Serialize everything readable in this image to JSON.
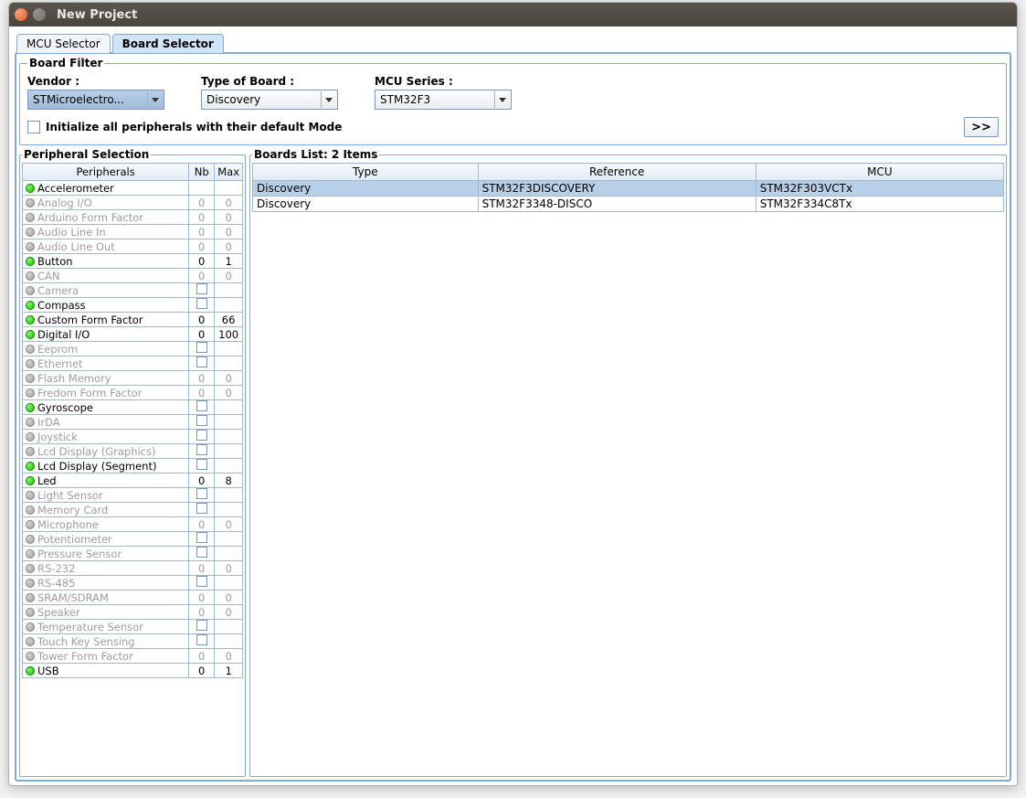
{
  "window": {
    "title": "New Project"
  },
  "tabs": {
    "mcu": "MCU Selector",
    "board": "Board Selector"
  },
  "filter": {
    "legend": "Board Filter",
    "vendor_label": "Vendor :",
    "vendor_value": "STMicroelectro...",
    "type_label": "Type of Board :",
    "type_value": "Discovery",
    "series_label": "MCU Series :",
    "series_value": "STM32F3",
    "init_label": "Initialize all peripherals with their default Mode",
    "next_label": ">>"
  },
  "peripherals": {
    "legend": "Peripheral Selection",
    "col_name": "Peripherals",
    "col_nb": "Nb",
    "col_max": "Max",
    "rows": [
      {
        "name": "Accelerometer",
        "active": true,
        "nb": "",
        "max": "",
        "chk": false
      },
      {
        "name": "Analog I/O",
        "active": false,
        "nb": "0",
        "max": "0",
        "chk": false
      },
      {
        "name": "Arduino Form Factor",
        "active": false,
        "nb": "0",
        "max": "0",
        "chk": false
      },
      {
        "name": "Audio Line In",
        "active": false,
        "nb": "0",
        "max": "0",
        "chk": false
      },
      {
        "name": "Audio Line Out",
        "active": false,
        "nb": "0",
        "max": "0",
        "chk": false
      },
      {
        "name": "Button",
        "active": true,
        "nb": "0",
        "max": "1",
        "chk": false
      },
      {
        "name": "CAN",
        "active": false,
        "nb": "0",
        "max": "0",
        "chk": false
      },
      {
        "name": "Camera",
        "active": false,
        "nb": "",
        "max": "",
        "chk": true
      },
      {
        "name": "Compass",
        "active": true,
        "nb": "",
        "max": "",
        "chk": true
      },
      {
        "name": "Custom Form Factor",
        "active": true,
        "nb": "0",
        "max": "66",
        "chk": false
      },
      {
        "name": "Digital I/O",
        "active": true,
        "nb": "0",
        "max": "100",
        "chk": false
      },
      {
        "name": "Eeprom",
        "active": false,
        "nb": "",
        "max": "",
        "chk": true
      },
      {
        "name": "Ethernet",
        "active": false,
        "nb": "",
        "max": "",
        "chk": true
      },
      {
        "name": "Flash Memory",
        "active": false,
        "nb": "0",
        "max": "0",
        "chk": false
      },
      {
        "name": "Fredom Form Factor",
        "active": false,
        "nb": "0",
        "max": "0",
        "chk": false
      },
      {
        "name": "Gyroscope",
        "active": true,
        "nb": "",
        "max": "",
        "chk": true
      },
      {
        "name": "IrDA",
        "active": false,
        "nb": "",
        "max": "",
        "chk": true
      },
      {
        "name": "Joystick",
        "active": false,
        "nb": "",
        "max": "",
        "chk": true
      },
      {
        "name": "Lcd Display (Graphics)",
        "active": false,
        "nb": "",
        "max": "",
        "chk": true
      },
      {
        "name": "Lcd Display (Segment)",
        "active": true,
        "nb": "",
        "max": "",
        "chk": true
      },
      {
        "name": "Led",
        "active": true,
        "nb": "0",
        "max": "8",
        "chk": false
      },
      {
        "name": "Light Sensor",
        "active": false,
        "nb": "",
        "max": "",
        "chk": true
      },
      {
        "name": "Memory Card",
        "active": false,
        "nb": "",
        "max": "",
        "chk": true
      },
      {
        "name": "Microphone",
        "active": false,
        "nb": "0",
        "max": "0",
        "chk": false
      },
      {
        "name": "Potentiometer",
        "active": false,
        "nb": "",
        "max": "",
        "chk": true
      },
      {
        "name": "Pressure Sensor",
        "active": false,
        "nb": "",
        "max": "",
        "chk": true
      },
      {
        "name": "RS-232",
        "active": false,
        "nb": "0",
        "max": "0",
        "chk": false
      },
      {
        "name": "RS-485",
        "active": false,
        "nb": "",
        "max": "",
        "chk": true
      },
      {
        "name": "SRAM/SDRAM",
        "active": false,
        "nb": "0",
        "max": "0",
        "chk": false
      },
      {
        "name": "Speaker",
        "active": false,
        "nb": "0",
        "max": "0",
        "chk": false
      },
      {
        "name": "Temperature Sensor",
        "active": false,
        "nb": "",
        "max": "",
        "chk": true
      },
      {
        "name": "Touch Key Sensing",
        "active": false,
        "nb": "",
        "max": "",
        "chk": true
      },
      {
        "name": "Tower Form Factor",
        "active": false,
        "nb": "0",
        "max": "0",
        "chk": false
      },
      {
        "name": "USB",
        "active": true,
        "nb": "0",
        "max": "1",
        "chk": false
      }
    ]
  },
  "boards": {
    "legend": "Boards List: 2 Items",
    "col_type": "Type",
    "col_ref": "Reference",
    "col_mcu": "MCU",
    "rows": [
      {
        "type": "Discovery",
        "ref": "STM32F3DISCOVERY",
        "mcu": "STM32F303VCTx",
        "selected": true
      },
      {
        "type": "Discovery",
        "ref": "STM32F3348-DISCO",
        "mcu": "STM32F334C8Tx",
        "selected": false
      }
    ]
  }
}
